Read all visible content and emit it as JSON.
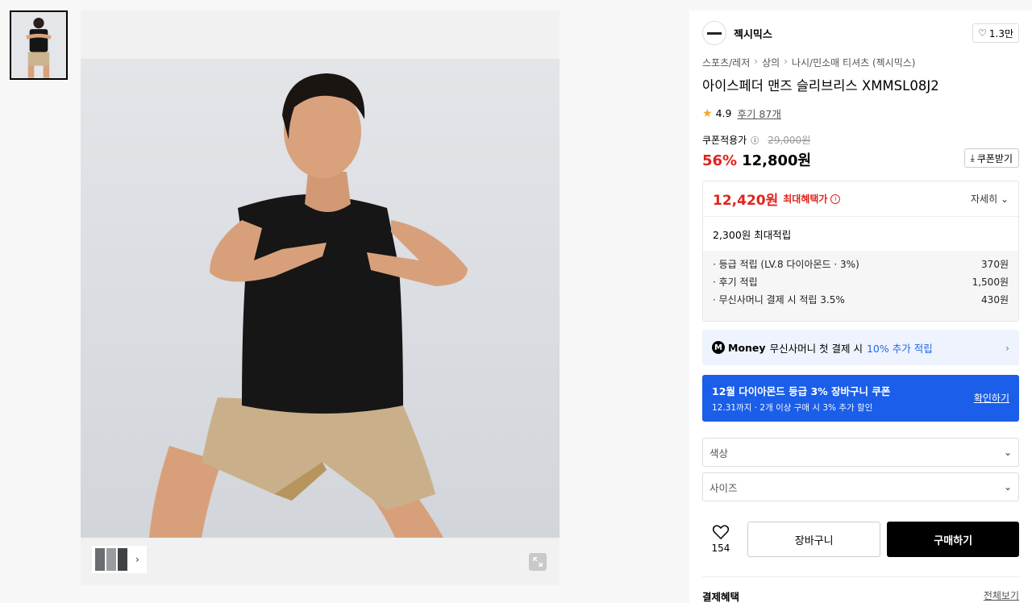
{
  "brand": {
    "name": "젝시믹스",
    "likes": "1.3만"
  },
  "breadcrumb": [
    "스포츠/레저",
    "상의",
    "나시/민소매 티셔츠 (젝시믹스)"
  ],
  "product": {
    "title": "아이스페더 맨즈 슬리브리스 XMMSL08J2"
  },
  "rating": {
    "score": "4.9",
    "reviews": "후기 87개"
  },
  "price": {
    "coupon_label": "쿠폰적용가",
    "original": "29,000원",
    "discount_pct": "56%",
    "final": "12,800원",
    "coupon_button": "쿠폰받기"
  },
  "benefit": {
    "max_price": "12,420원",
    "max_tag": "최대혜택가",
    "detail": "자세히",
    "point_title": "2,300원 최대적립",
    "points": [
      {
        "label": "· 등급 적립 (LV.8 다이아몬드 · 3%)",
        "value": "370원"
      },
      {
        "label": "· 후기 적립",
        "value": "1,500원"
      },
      {
        "label": "· 무신사머니 결제 시 적립 3.5%",
        "value": "430원"
      }
    ]
  },
  "money": {
    "badge": "M",
    "brand": "Money",
    "text": "무신사머니 첫 결제 시",
    "highlight": "10% 추가 적립"
  },
  "coupon_banner": {
    "title": "12월 다이아몬드 등급 3% 장바구니 쿠폰",
    "subtitle": "12.31까지 · 2개 이상 구매 시 3% 추가 할인",
    "link": "확인하기"
  },
  "options": {
    "color": "색상",
    "size": "사이즈"
  },
  "actions": {
    "wish_count": "154",
    "cart": "장바구니",
    "buy": "구매하기"
  },
  "payment": {
    "label": "결제혜택",
    "all": "전체보기"
  }
}
